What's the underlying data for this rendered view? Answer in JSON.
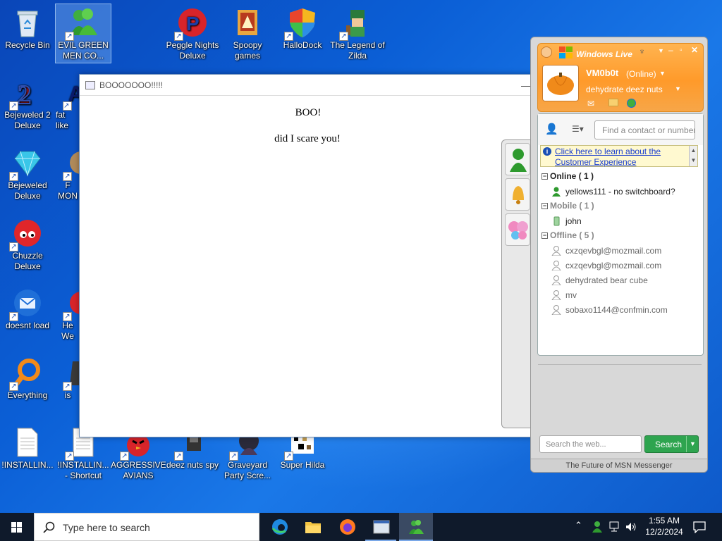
{
  "desktop": {
    "icons": [
      {
        "label": "Recycle Bin"
      },
      {
        "label": "EVIL GREEN MEN CO..."
      },
      {
        "label": "Peggle Nights Deluxe"
      },
      {
        "label": "Spoopy games"
      },
      {
        "label": "HalloDock"
      },
      {
        "label": "The Legend of Zilda"
      },
      {
        "label": "Bejeweled 2 Deluxe"
      },
      {
        "label": "fat like"
      },
      {
        "label": "Bejeweled Deluxe"
      },
      {
        "label": "F MON"
      },
      {
        "label": "Chuzzle Deluxe"
      },
      {
        "label": "doesnt load"
      },
      {
        "label": "He We"
      },
      {
        "label": "Everything"
      },
      {
        "label": "is"
      },
      {
        "label": "!INSTALLIN..."
      },
      {
        "label": "!INSTALLIN... - Shortcut"
      },
      {
        "label": "AGGRESSIVE AVIANS"
      },
      {
        "label": "deez nuts spy"
      },
      {
        "label": "Graveyard Party Scre..."
      },
      {
        "label": "Super Hilda"
      }
    ]
  },
  "popup": {
    "title": "BOOOOOOO!!!!!",
    "line1": "BOO!",
    "line2": "did I scare you!"
  },
  "msn": {
    "brand": "Windows Live",
    "username": "VM0b0t",
    "status": "(Online)",
    "personal_message": "dehydrate deez nuts",
    "find_placeholder": "Find a contact or number",
    "info_link": "Click here to learn about the Customer Experience",
    "groups": [
      {
        "name": "Online ( 1 )",
        "contacts": [
          "yellows111 - no switchboard?"
        ]
      },
      {
        "name": "Mobile ( 1 )",
        "contacts": [
          "john"
        ]
      },
      {
        "name": "Offline ( 5 )",
        "contacts": [
          "cxzqevbgl@mozmail.com",
          "cxzqevbgl@mozmail.com",
          "dehydrated bear cube",
          "mv",
          "sobaxo1144@confmin.com"
        ]
      }
    ],
    "web_search_placeholder": "Search the web...",
    "search_button": "Search",
    "footer": "The Future of MSN Messenger"
  },
  "taskbar": {
    "search_placeholder": "Type here to search",
    "time": "1:55 AM",
    "date": "12/2/2024"
  },
  "colors": {
    "msn_orange": "#ff9a2a",
    "search_green": "#2ea44f",
    "taskbar": "#0f1a2b"
  }
}
